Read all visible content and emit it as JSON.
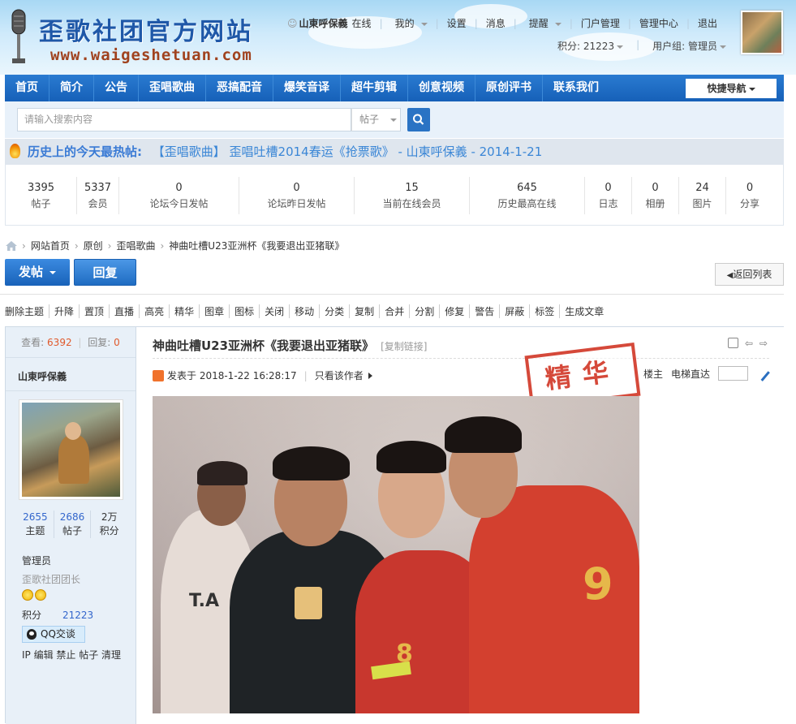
{
  "site": {
    "title": "歪歌社团官方网站",
    "url": "www.waigeshetuan.com"
  },
  "userbar": {
    "username": "山東呼保義",
    "status": "在线",
    "links": [
      "我的",
      "设置",
      "消息",
      "提醒",
      "门户管理",
      "管理中心",
      "退出"
    ],
    "credits": "积分: 21223",
    "group": "用户组: 管理员"
  },
  "nav": {
    "items": [
      "首页",
      "简介",
      "公告",
      "歪唱歌曲",
      "恶搞配音",
      "爆笑音译",
      "超牛剪辑",
      "创意视频",
      "原创评书",
      "联系我们"
    ],
    "quick": "快捷导航"
  },
  "search": {
    "placeholder": "请输入搜索内容",
    "type": "帖子"
  },
  "hot": {
    "label": "历史上的今天最热帖:",
    "link": "【歪唱歌曲】 歪唱吐槽2014春运《抢票歌》 - 山東呼保義 - 2014-1-21"
  },
  "stats": [
    {
      "value": "3395",
      "label": "帖子"
    },
    {
      "value": "5337",
      "label": "会员"
    },
    {
      "value": "0",
      "label": "论坛今日发帖"
    },
    {
      "value": "0",
      "label": "论坛昨日发帖"
    },
    {
      "value": "15",
      "label": "当前在线会员"
    },
    {
      "value": "645",
      "label": "历史最高在线"
    },
    {
      "value": "0",
      "label": "日志"
    },
    {
      "value": "0",
      "label": "相册"
    },
    {
      "value": "24",
      "label": "图片"
    },
    {
      "value": "0",
      "label": "分享"
    }
  ],
  "breadcrumb": [
    "网站首页",
    "原创",
    "歪唱歌曲",
    "神曲吐槽U23亚洲杯《我要退出亚猪联》"
  ],
  "buttons": {
    "post": "发帖",
    "reply": "回复",
    "back": "返回列表"
  },
  "mod_actions": [
    "删除主题",
    "升降",
    "置顶",
    "直播",
    "高亮",
    "精华",
    "图章",
    "图标",
    "关闭",
    "移动",
    "分类",
    "复制",
    "合并",
    "分割",
    "修复",
    "警告",
    "屏蔽",
    "标签",
    "生成文章"
  ],
  "sidebar": {
    "views_label": "查看:",
    "views": "6392",
    "replies_label": "回复:",
    "replies": "0",
    "username": "山東呼保義",
    "stats": [
      {
        "value": "2655",
        "label": "主题"
      },
      {
        "value": "2686",
        "label": "帖子"
      },
      {
        "value": "2万",
        "label": "积分"
      }
    ],
    "role": "管理员",
    "title": "歪歌社团团长",
    "credit_label": "积分",
    "credit_value": "21223",
    "qq": "QQ交谈",
    "ops": "IP 编辑 禁止 帖子 清理"
  },
  "post": {
    "title": "神曲吐槽U23亚洲杯《我要退出亚猪联》",
    "copy_link": "[复制链接]",
    "posted": "发表于 2018-1-22 16:28:17",
    "only_author": "只看该作者",
    "floor": "楼主",
    "jump": "电梯直达",
    "stamp": "精华"
  },
  "colors": {
    "nav": "#1a66bd",
    "accent": "#3a86d6",
    "stamp": "#d23a2a"
  }
}
